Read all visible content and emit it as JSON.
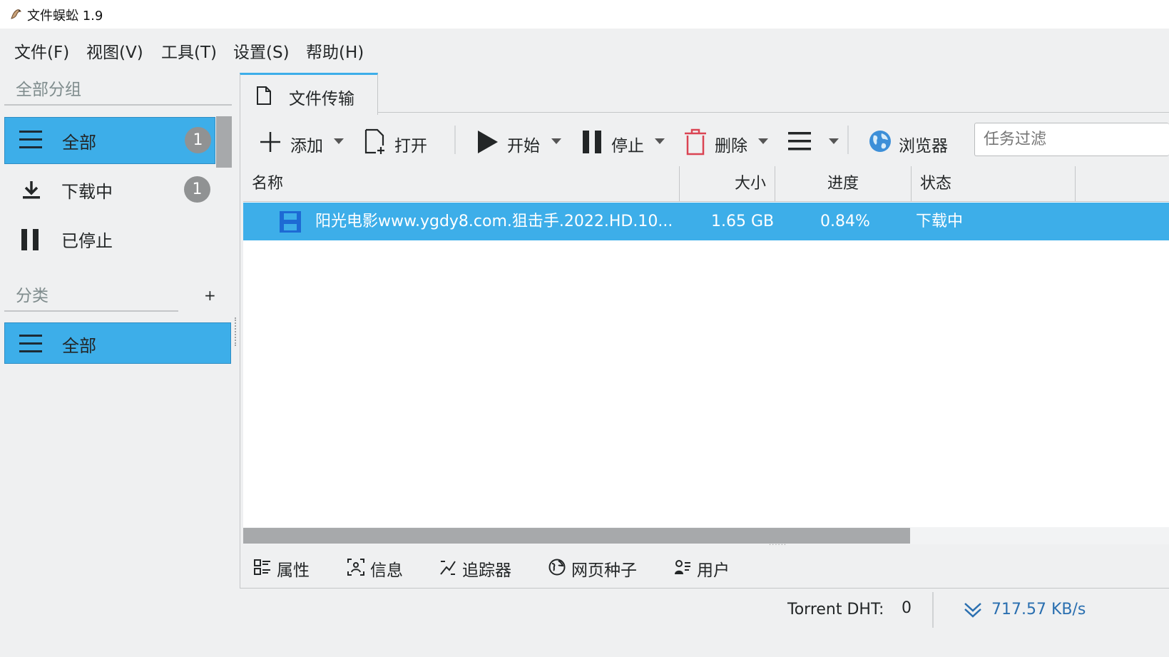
{
  "window": {
    "title": "文件蜈蚣 1.9"
  },
  "menu": [
    "文件(F)",
    "视图(V)",
    "工具(T)",
    "设置(S)",
    "帮助(H)"
  ],
  "sidebar": {
    "groups_title": "全部分组",
    "groups": [
      {
        "label": "全部",
        "count": "1",
        "icon": "hamburger-icon",
        "selected": true
      },
      {
        "label": "下载中",
        "count": "1",
        "icon": "download-icon",
        "selected": false
      },
      {
        "label": "已停止",
        "count": "",
        "icon": "pause-icon",
        "selected": false
      }
    ],
    "categories_title": "分类",
    "add_label": "+",
    "categories": [
      {
        "label": "全部",
        "icon": "hamburger-icon",
        "selected": true
      }
    ]
  },
  "tab": {
    "label": "文件传输"
  },
  "toolbar": {
    "add": "添加",
    "open": "打开",
    "start": "开始",
    "stop": "停止",
    "delete": "删除",
    "browser": "浏览器",
    "filter_placeholder": "任务过滤"
  },
  "table": {
    "columns": [
      "名称",
      "大小",
      "进度",
      "状态"
    ],
    "rows": [
      {
        "name": "阳光电影www.ygdy8.com.狙击手.2022.HD.10...",
        "size": "1.65 GB",
        "progress": "0.84%",
        "status": "下载中"
      }
    ]
  },
  "bottom_tabs": [
    "属性",
    "信息",
    "追踪器",
    "网页种子",
    "用户"
  ],
  "status": {
    "dht_label": "Torrent DHT:",
    "dht_value": "0",
    "speed": "717.57 KB/s"
  },
  "colors": {
    "accent": "#3daee9",
    "background": "#eff0f1",
    "delete_red": "#da4453"
  }
}
